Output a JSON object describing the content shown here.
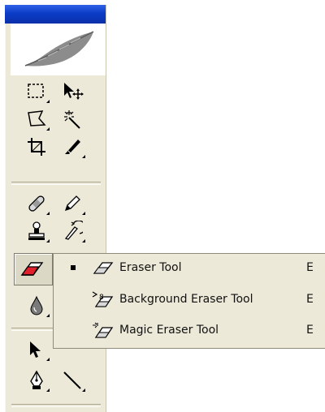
{
  "palette": {
    "logo_icon": "feather-icon",
    "tools": [
      {
        "name": "marquee",
        "icon": "rectangular-marquee-icon"
      },
      {
        "name": "move",
        "icon": "move-icon"
      },
      {
        "name": "lasso",
        "icon": "polygonal-lasso-icon"
      },
      {
        "name": "magic-wand",
        "icon": "magic-wand-icon"
      },
      {
        "name": "crop",
        "icon": "crop-icon"
      },
      {
        "name": "slice",
        "icon": "slice-icon"
      },
      {
        "name": "healing-brush",
        "icon": "bandage-icon"
      },
      {
        "name": "pencil",
        "icon": "pencil-icon"
      },
      {
        "name": "clone-stamp",
        "icon": "stamp-icon"
      },
      {
        "name": "history-brush",
        "icon": "history-brush-icon"
      },
      {
        "name": "eraser",
        "icon": "eraser-icon",
        "active": true
      },
      {
        "name": "blur",
        "icon": "water-drop-icon"
      },
      {
        "name": "path-selection",
        "icon": "arrow-pointer-icon"
      },
      {
        "name": "pen",
        "icon": "pen-nib-icon"
      },
      {
        "name": "line",
        "icon": "line-icon"
      }
    ]
  },
  "flyout": {
    "items": [
      {
        "label": "Eraser Tool",
        "shortcut": "E",
        "selected": true,
        "icon": "eraser-icon"
      },
      {
        "label": "Background Eraser Tool",
        "shortcut": "E",
        "selected": false,
        "icon": "background-eraser-icon"
      },
      {
        "label": "Magic Eraser Tool",
        "shortcut": "E",
        "selected": false,
        "icon": "magic-eraser-icon"
      }
    ]
  },
  "colors": {
    "titlebar": "#0a3cc8",
    "palette_bg": "#ece9d8",
    "eraser_accent": "#e0202a"
  }
}
